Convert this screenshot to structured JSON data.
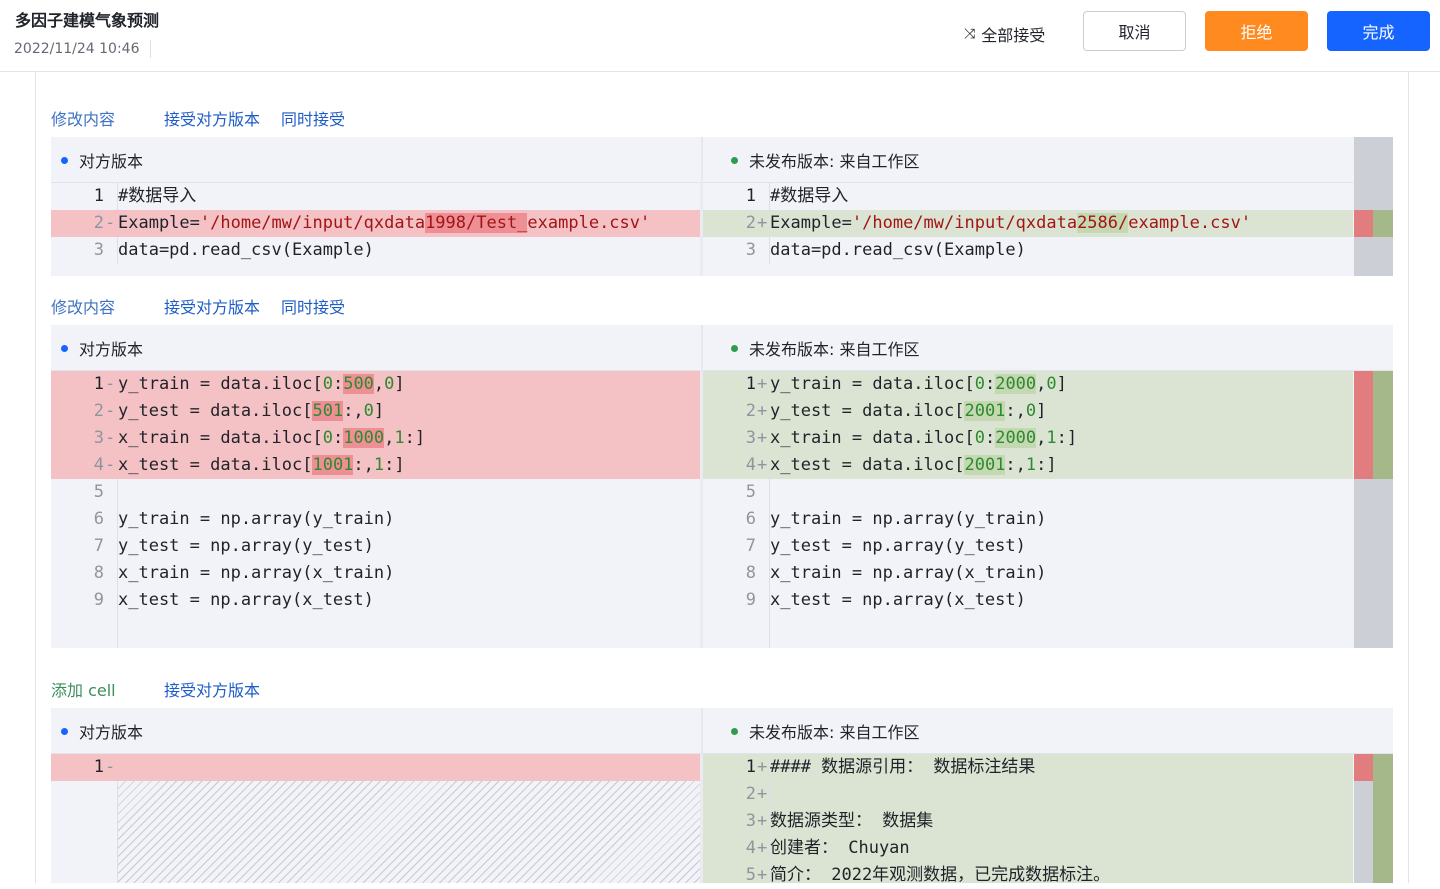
{
  "header": {
    "title": "多因子建模气象预测",
    "date": "2022/11/24 10:46",
    "accept_all_label": "全部接受",
    "cancel_label": "取消",
    "reject_label": "拒绝",
    "done_label": "完成"
  },
  "labels": {
    "left_version": "对方版本",
    "right_version": "未发布版本: 来自工作区",
    "modified": "修改内容",
    "added_cell": "添加 cell",
    "accept_theirs": "接受对方版本",
    "accept_both": "同时接受"
  },
  "colors": {
    "accent": "#1664ff",
    "reject": "#ff8a1f",
    "deleted_line": "#f4c1c5",
    "added_line": "#dbe4d3"
  },
  "hunks": [
    {
      "kind": "修改内容",
      "left": [
        {
          "n": "1",
          "m": "",
          "t": "#数据导入"
        },
        {
          "n": "2",
          "m": "-",
          "t": "Example='/home/mw/input/qxdata1998/Test_example.csv'"
        },
        {
          "n": "3",
          "m": "",
          "t": "data=pd.read_csv(Example)"
        }
      ],
      "right": [
        {
          "n": "1",
          "m": "",
          "t": "#数据导入"
        },
        {
          "n": "2",
          "m": "+",
          "t": "Example='/home/mw/input/qxdata2586/example.csv'"
        },
        {
          "n": "3",
          "m": "",
          "t": "data=pd.read_csv(Example)"
        }
      ]
    },
    {
      "kind": "修改内容",
      "left": [
        {
          "n": "1",
          "m": "-",
          "t": "y_train = data.iloc[0:500,0]"
        },
        {
          "n": "2",
          "m": "-",
          "t": "y_test = data.iloc[501:,0]"
        },
        {
          "n": "3",
          "m": "-",
          "t": "x_train = data.iloc[0:1000,1:]"
        },
        {
          "n": "4",
          "m": "-",
          "t": "x_test = data.iloc[1001:,1:]"
        },
        {
          "n": "5",
          "m": "",
          "t": ""
        },
        {
          "n": "6",
          "m": "",
          "t": "y_train = np.array(y_train)"
        },
        {
          "n": "7",
          "m": "",
          "t": "y_test = np.array(y_test)"
        },
        {
          "n": "8",
          "m": "",
          "t": "x_train = np.array(x_train)"
        },
        {
          "n": "9",
          "m": "",
          "t": "x_test = np.array(x_test)"
        }
      ],
      "right": [
        {
          "n": "1",
          "m": "+",
          "t": "y_train = data.iloc[0:2000,0]"
        },
        {
          "n": "2",
          "m": "+",
          "t": "y_test = data.iloc[2001:,0]"
        },
        {
          "n": "3",
          "m": "+",
          "t": "x_train = data.iloc[0:2000,1:]"
        },
        {
          "n": "4",
          "m": "+",
          "t": "x_test = data.iloc[2001:,1:]"
        },
        {
          "n": "5",
          "m": "",
          "t": ""
        },
        {
          "n": "6",
          "m": "",
          "t": "y_train = np.array(y_train)"
        },
        {
          "n": "7",
          "m": "",
          "t": "y_test = np.array(y_test)"
        },
        {
          "n": "8",
          "m": "",
          "t": "x_train = np.array(x_train)"
        },
        {
          "n": "9",
          "m": "",
          "t": "x_test = np.array(x_test)"
        }
      ]
    },
    {
      "kind": "添加 cell",
      "left": [
        {
          "n": "1",
          "m": "-",
          "t": ""
        }
      ],
      "right": [
        {
          "n": "1",
          "m": "+",
          "t": "#### 数据源引用： 数据标注结果"
        },
        {
          "n": "2",
          "m": "+",
          "t": ""
        },
        {
          "n": "3",
          "m": "+",
          "t": "数据源类型： 数据集"
        },
        {
          "n": "4",
          "m": "+",
          "t": "创建者： Chuyan"
        },
        {
          "n": "5",
          "m": "+",
          "t": "简介： 2022年观测数据，已完成数据标注。"
        }
      ]
    }
  ]
}
